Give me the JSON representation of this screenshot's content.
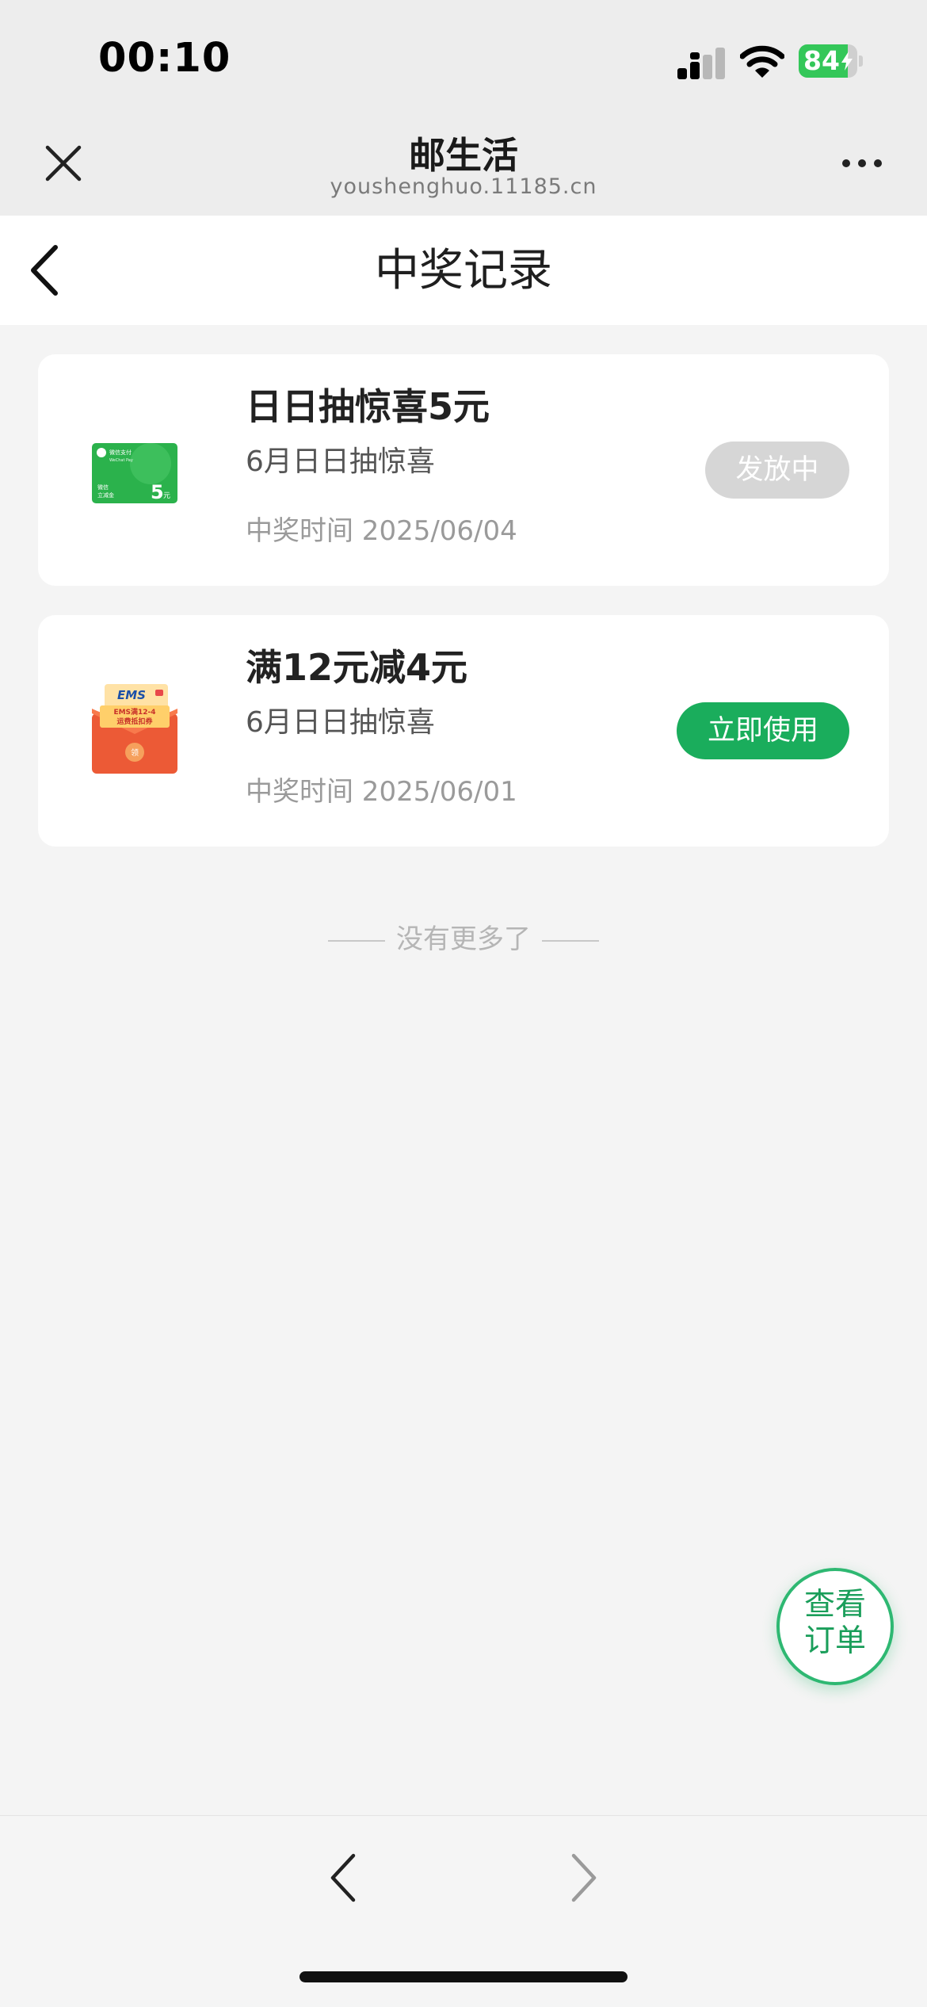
{
  "status_bar": {
    "time": "00:10",
    "battery": "84",
    "battery_level": 0.84
  },
  "header": {
    "title": "邮生活",
    "url": "youshenghuo.11185.cn"
  },
  "nav": {
    "title": "中奖记录"
  },
  "records": [
    {
      "title": "日日抽惊喜5元",
      "subtitle": "6月日日抽惊喜",
      "time": "中奖时间 2025/06/04",
      "action": "发放中",
      "icon": "wechat-pay-coupon-icon"
    },
    {
      "title": "满12元减4元",
      "subtitle": "6月日日抽惊喜",
      "time": "中奖时间 2025/06/01",
      "action": "立即使用",
      "icon": "ems-red-envelope-icon"
    }
  ],
  "thumb_texts": {
    "wechat_card_brand": "微信支付",
    "wechat_card_sub": "WeChat Pay",
    "wechat_card_label_1": "微信",
    "wechat_card_label_2": "立减金",
    "wechat_card_amount": "5",
    "wechat_card_unit": "元",
    "ems_logo": "EMS",
    "ems_line_1": "EMS满12-4",
    "ems_line_2": "运费抵扣券",
    "ems_seal": "领"
  },
  "end_text": "没有更多了",
  "float_button": {
    "line1": "查看",
    "line2": "订单"
  },
  "colors": {
    "accent": "#1aad5c",
    "battery": "#34c759",
    "pending": "#d6d6d6"
  }
}
